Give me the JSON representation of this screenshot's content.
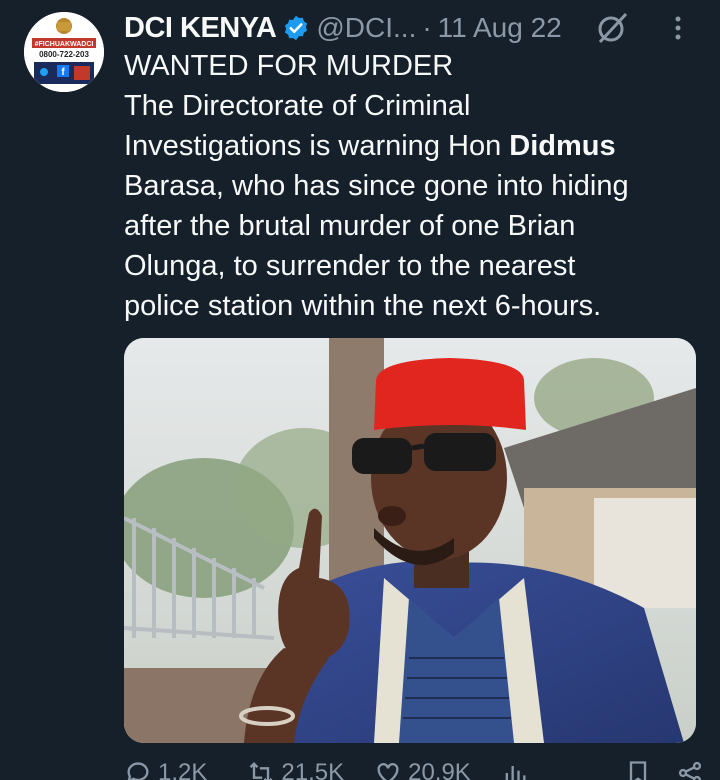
{
  "author": {
    "name": "DCI KENYA",
    "handle": "@DCI...",
    "separator": "·",
    "date": "11 Aug 22",
    "avatar_text_top": "#FICHUAKWADCI",
    "avatar_text_phone": "0800-722-203"
  },
  "tweet": {
    "line1": "WANTED FOR MURDER",
    "line2": "The Directorate of Criminal",
    "line3_pre": "Investigations is warning Hon ",
    "line3_bold": "Didmus",
    "line4": "Barasa, who has since gone into hiding",
    "line5": "after the brutal murder of one Brian",
    "line6": "Olunga, to surrender to the nearest",
    "line7": "police station within the next 6-hours."
  },
  "actions": {
    "replies": "1.2K",
    "retweets": "21.5K",
    "likes": "20.9K"
  },
  "colors": {
    "background": "#15202b",
    "text": "#f7f9f9",
    "muted": "#8b98a5",
    "verified": "#1d9bf0"
  }
}
